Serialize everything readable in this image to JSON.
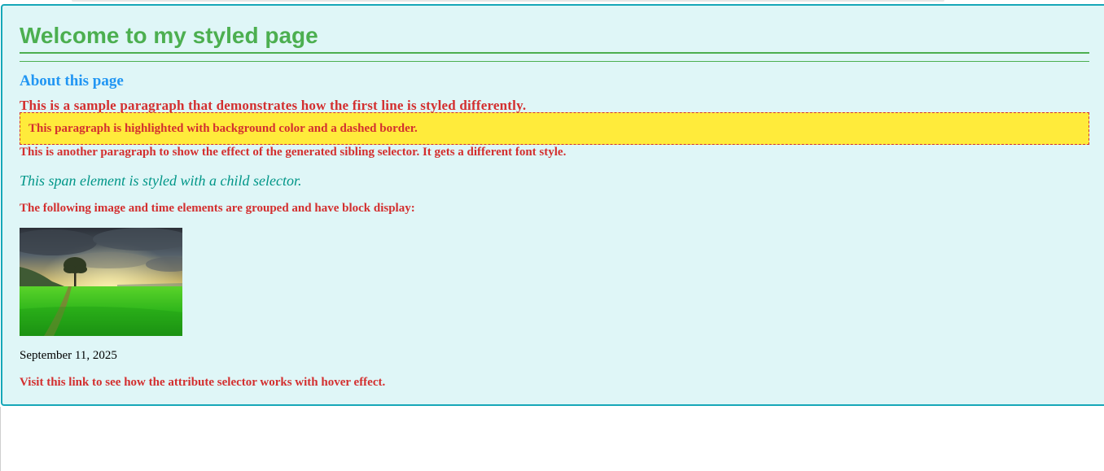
{
  "header": {
    "title": "Welcome to my styled page"
  },
  "section": {
    "title": "About this page"
  },
  "paragraphs": {
    "first": "This is a sample paragraph that demonstrates how the first line is styled differently.",
    "highlighted": "This paragraph is highlighted with background color and a dashed border.",
    "sibling": "This is another paragraph to show the effect of the generated sibling selector. It gets a different font style.",
    "span_child": "This span element is styled with a child selector.",
    "group_intro": "The following image and time elements are grouped and have block display:"
  },
  "time": {
    "text": "September 11, 2025"
  },
  "link": {
    "text": "Visit this link to see how the attribute selector works with hover effect."
  },
  "colors": {
    "title_green": "#4caf50",
    "section_blue": "#2196f3",
    "text_red": "#d32f2f",
    "highlight_yellow": "#ffeb3b",
    "teal": "#009688",
    "container_bg": "#dff6f7",
    "container_border": "#16a7b8"
  }
}
